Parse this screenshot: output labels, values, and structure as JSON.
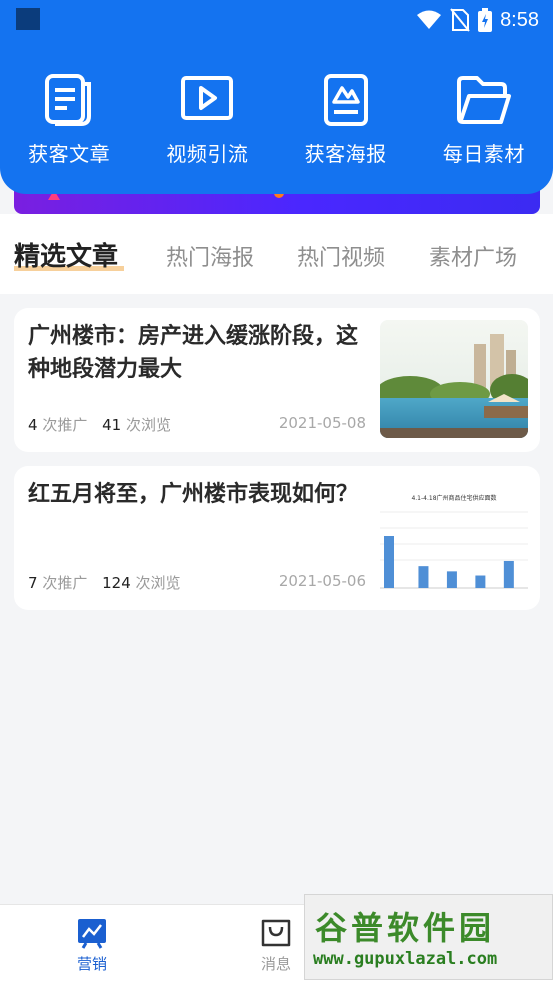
{
  "status_bar": {
    "time": "8:58"
  },
  "quick_actions": [
    {
      "icon": "document-icon",
      "label": "获客文章"
    },
    {
      "icon": "video-play-icon",
      "label": "视频引流"
    },
    {
      "icon": "poster-icon",
      "label": "获客海报"
    },
    {
      "icon": "folder-icon",
      "label": "每日素材"
    }
  ],
  "tabs": [
    {
      "label": "精选文章",
      "active": true
    },
    {
      "label": "热门海报",
      "active": false
    },
    {
      "label": "热门视频",
      "active": false
    },
    {
      "label": "素材广场",
      "active": false
    }
  ],
  "articles": [
    {
      "title": "广州楼市：房产进入缓涨阶段，这种地段潜力最大",
      "promotions": "4",
      "promotions_label": "次推广",
      "views": "41",
      "views_label": "次浏览",
      "date": "2021-05-08",
      "thumbnail": "residential-lake-photo"
    },
    {
      "title": "红五月将至，广州楼市表现如何？",
      "promotions": "7",
      "promotions_label": "次推广",
      "views": "124",
      "views_label": "次浏览",
      "date": "2021-05-06",
      "thumbnail": "bar-chart-image",
      "thumbnail_title": "4.1-4.18广州商品住宅供应面数",
      "thumbnail_values": [
        100,
        42,
        32,
        24,
        52
      ]
    }
  ],
  "bottom_nav": [
    {
      "icon": "marketing-icon",
      "label": "营销",
      "active": true
    },
    {
      "icon": "shopping-bag-icon",
      "label": "消息",
      "active": false
    }
  ],
  "watermark": {
    "title": "谷普软件园",
    "url": "www.gupuxlazal.com"
  },
  "colors": {
    "primary": "#1473f0",
    "banner": "#4a27ff",
    "tab_underline": "#f4c07a",
    "nav_active": "#1a5fd0"
  }
}
